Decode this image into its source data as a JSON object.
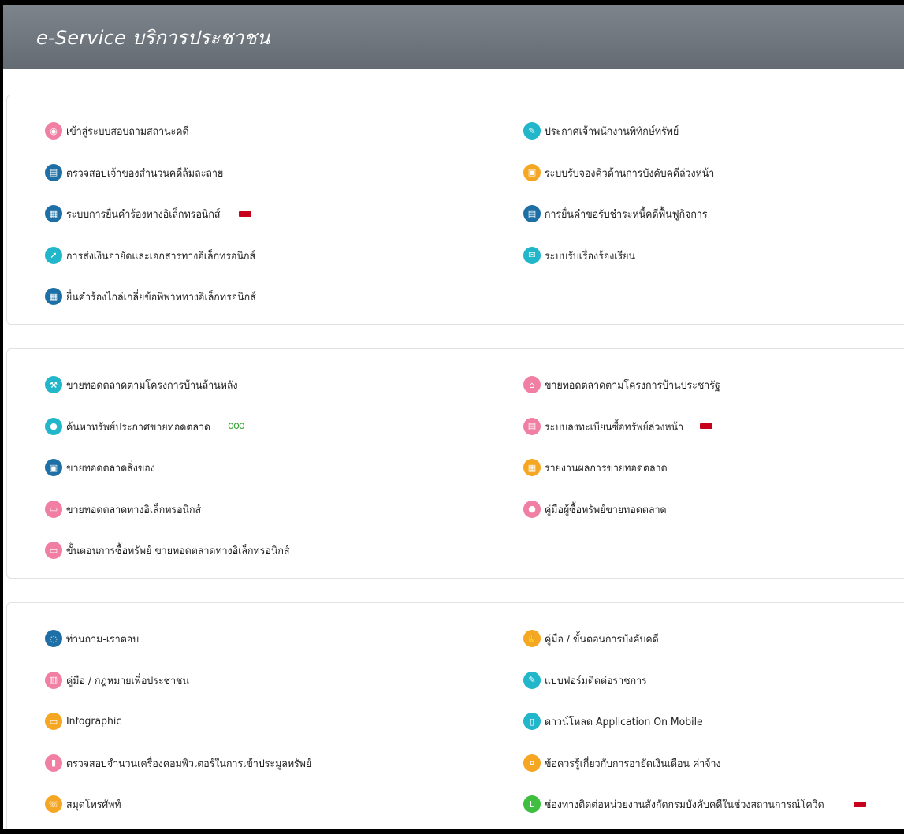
{
  "header": {
    "title": "e-Service บริการประชาชน"
  },
  "sections": [
    {
      "left": [
        {
          "label": "เข้าสู่ระบบสอบถามสถานะคดี",
          "icon": "person-search-icon",
          "color": "#f07fa3"
        },
        {
          "label": "ตรวจสอบเจ้าของสำนวนคดีล้มละลาย",
          "icon": "document-icon",
          "color": "#1d6fa5"
        },
        {
          "label": "ระบบการยื่นคำร้องทางอิเล็กทรอนิกส์",
          "icon": "form-icon",
          "color": "#1d6fa5",
          "badge": "new"
        },
        {
          "label": "การส่งเงินอายัดและเอกสารทางอิเล็กทรอนิกส์",
          "icon": "send-icon",
          "color": "#21b6c9"
        },
        {
          "label": "ยื่นคำร้องไกล่เกลี่ยข้อพิพาททางอิเล็กทรอนิกส์",
          "icon": "form-icon",
          "color": "#1d6fa5"
        }
      ],
      "right": [
        {
          "label": "ประกาศเจ้าพนักงานพิทักษ์ทรัพย์",
          "icon": "megaphone-icon",
          "color": "#21b6c9"
        },
        {
          "label": "ระบบรับจองคิวด้านการบังคับคดีล่วงหน้า",
          "icon": "calendar-icon",
          "color": "#f5a623"
        },
        {
          "label": "การยื่นคำขอรับชำระหนี้คดีฟื้นฟูกิจการ",
          "icon": "clipboard-icon",
          "color": "#1d6fa5"
        },
        {
          "label": "ระบบรับเรื่องร้องเรียน",
          "icon": "complaint-icon",
          "color": "#21b6c9"
        }
      ]
    },
    {
      "left": [
        {
          "label": "ขายทอดตลาดตามโครงการบ้านล้านหลัง",
          "icon": "gavel-icon",
          "color": "#21b6c9"
        },
        {
          "label": "ค้นหาทรัพย์ประกาศขายทอดตลาด",
          "icon": "pin-icon",
          "color": "#21b6c9",
          "badge": "dots"
        },
        {
          "label": "ขายทอดตลาดสิ่งของ",
          "icon": "cart-icon",
          "color": "#1d6fa5"
        },
        {
          "label": "ขายทอดตลาดทางอิเล็กทรอนิกส์",
          "icon": "computer-icon",
          "color": "#f07fa3"
        },
        {
          "label": "ขั้นตอนการซื้อทรัพย์ ขายทอดตลาดทางอิเล็กทรอนิกส์",
          "icon": "monitor-icon",
          "color": "#f07fa3"
        }
      ],
      "right": [
        {
          "label": "ขายทอดตลาดตามโครงการบ้านประชารัฐ",
          "icon": "house-icon",
          "color": "#f07fa3"
        },
        {
          "label": "ระบบลงทะเบียนซื้อทรัพย์ล่วงหน้า",
          "icon": "register-icon",
          "color": "#f07fa3",
          "badge": "new"
        },
        {
          "label": "รายงานผลการขายทอดตลาด",
          "icon": "report-icon",
          "color": "#f5a623"
        },
        {
          "label": "คู่มือผู้ซื้อทรัพย์ขายทอดตลาด",
          "icon": "pin-icon",
          "color": "#f07fa3"
        }
      ]
    },
    {
      "left": [
        {
          "label": "ท่านถาม-เราตอบ",
          "icon": "chat-icon",
          "color": "#1d6fa5"
        },
        {
          "label": "คู่มือ / กฎหมายเพื่อประชาชน",
          "icon": "book-icon",
          "color": "#f07fa3"
        },
        {
          "label": "Infographic",
          "icon": "chart-icon",
          "color": "#f5a623"
        },
        {
          "label": "ตรวจสอบจำนวนเครื่องคอมพิวเตอร์ในการเข้าประมูลทรัพย์",
          "icon": "bar-chart-icon",
          "color": "#f07fa3"
        },
        {
          "label": "สมุดโทรศัพท์",
          "icon": "phone-icon",
          "color": "#f5a623"
        }
      ],
      "right": [
        {
          "label": "คู่มือ / ขั้นตอนการบังคับคดี",
          "icon": "hand-icon",
          "color": "#f5a623"
        },
        {
          "label": "แบบฟอร์มติดต่อราชการ",
          "icon": "pen-icon",
          "color": "#21b6c9"
        },
        {
          "label": "ดาวน์โหลด Application On Mobile",
          "icon": "mobile-icon",
          "color": "#21b6c9"
        },
        {
          "label": "ข้อควรรู้เกี่ยวกับการอายัดเงินเดือน ค่าจ้าง",
          "icon": "money-icon",
          "color": "#f5a623"
        },
        {
          "label": "ช่องทางติดต่อหน่วยงานสังกัดกรมบังคับคดีในช่วงสถานการณ์โควิด",
          "icon": "line-icon",
          "color": "#3fbf3f",
          "badge": "new"
        }
      ]
    }
  ]
}
